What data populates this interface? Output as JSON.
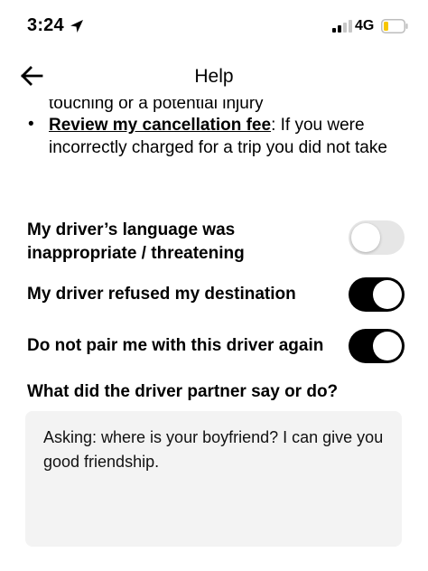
{
  "status_bar": {
    "time": "3:24",
    "network": "4G",
    "icons": [
      "location-arrow-icon",
      "signal-icon",
      "battery-icon"
    ],
    "battery_color": "#f7c600"
  },
  "header": {
    "title": "Help",
    "back_icon": "arrow-left-icon"
  },
  "help_text": {
    "clipped_line": "touching or a potential injury",
    "bullet_glyph": "•",
    "link_label": "Review my cancellation fee",
    "link_suffix": ": If you were incorrectly charged for a trip you did not take"
  },
  "options": [
    {
      "label": "My driver’s language was inappropriate / threatening",
      "enabled": false
    },
    {
      "label": "My driver refused my destination",
      "enabled": true
    },
    {
      "label": "Do not pair me with this driver again",
      "enabled": true
    }
  ],
  "question": {
    "label": "What did the driver partner say or do?",
    "answer": "Asking: where is your boyfriend? I can give you good friendship."
  },
  "colors": {
    "toggle_on": "#000000",
    "toggle_off": "#e6e6e6",
    "input_bg": "#f3f3f3"
  }
}
